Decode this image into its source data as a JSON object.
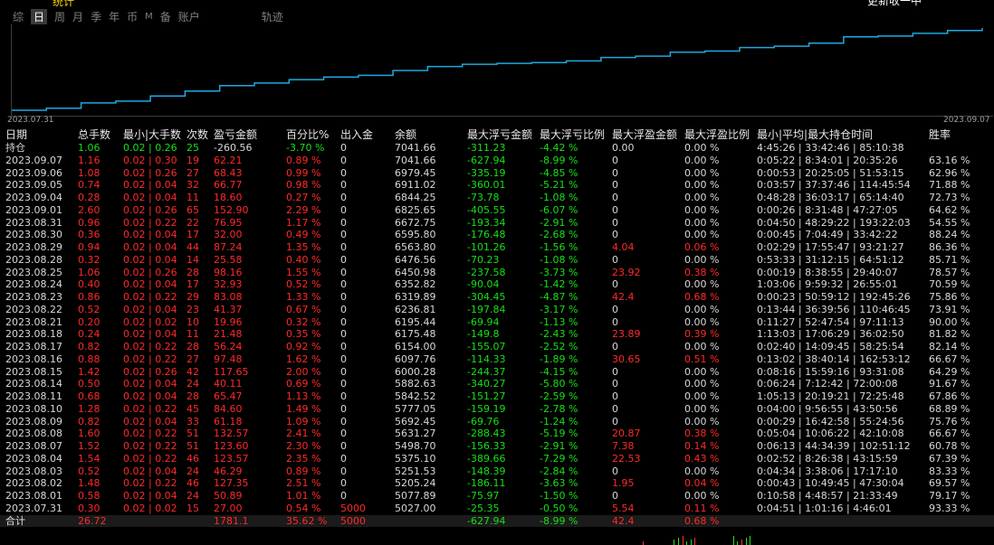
{
  "topbar": {
    "title_fragment": "统计",
    "right_fragment": "更新收一中",
    "tabs": [
      {
        "label": "综",
        "selected": false
      },
      {
        "label": "日",
        "selected": true
      },
      {
        "label": "周",
        "selected": false
      },
      {
        "label": "月",
        "selected": false
      },
      {
        "label": "季",
        "selected": false
      },
      {
        "label": "年",
        "selected": false
      },
      {
        "label": "币",
        "selected": false
      },
      {
        "label": "M",
        "selected": false
      },
      {
        "label": "备",
        "selected": false
      },
      {
        "label": "账户",
        "selected": false
      },
      {
        "label": "轨迹",
        "selected": false
      }
    ]
  },
  "chart_data": {
    "type": "line",
    "start_label": "2023.07.31",
    "end_label": "2023.09.07",
    "line_color": "#1fa8e0",
    "x": [
      "2023.07.31",
      "2023.08.01",
      "2023.08.02",
      "2023.08.03",
      "2023.08.04",
      "2023.08.07",
      "2023.08.08",
      "2023.08.09",
      "2023.08.10",
      "2023.08.11",
      "2023.08.14",
      "2023.08.15",
      "2023.08.16",
      "2023.08.17",
      "2023.08.18",
      "2023.08.21",
      "2023.08.22",
      "2023.08.23",
      "2023.08.24",
      "2023.08.25",
      "2023.08.28",
      "2023.08.29",
      "2023.08.30",
      "2023.08.31",
      "2023.09.01",
      "2023.09.04",
      "2023.09.05",
      "2023.09.06",
      "2023.09.07"
    ],
    "values": [
      5027.0,
      5077.89,
      5205.24,
      5251.53,
      5375.1,
      5498.7,
      5631.27,
      5692.45,
      5777.05,
      5842.52,
      5882.63,
      6000.28,
      6097.76,
      6154.0,
      6175.48,
      6195.44,
      6236.81,
      6319.89,
      6352.82,
      6450.98,
      6476.56,
      6563.8,
      6595.8,
      6672.75,
      6825.65,
      6844.25,
      6911.02,
      6979.45,
      7041.66
    ]
  },
  "table": {
    "headers": [
      "日期",
      "总手数",
      "最小|大手数",
      "次数",
      "盈亏金额",
      "百分比%",
      "出入金",
      "余额",
      "最大浮亏金额",
      "最大浮亏比例",
      "最大浮盈金额",
      "最大浮盈比例",
      "最小|平均|最大持仓时间",
      "胜率"
    ],
    "position_row": {
      "date": "持仓",
      "lots": "1.06",
      "minmax": "0.02 | 0.26",
      "count": "25",
      "pnl": "-260.56",
      "pct": "-3.70 %",
      "io": "0",
      "balance": "7041.66",
      "maxloss": "-311.23",
      "maxlosspct": "-4.42 %",
      "maxgain": "0.00",
      "maxgainpct": "0.00 %",
      "hold": "4:45:26 | 33:42:46 | 85:10:38",
      "win": ""
    },
    "rows": [
      {
        "date": "2023.09.07",
        "lots": "1.16",
        "minmax": "0.02 | 0.30",
        "count": "19",
        "pnl": "62.21",
        "pct": "0.89 %",
        "io": "0",
        "balance": "7041.66",
        "maxloss": "-627.94",
        "maxlosspct": "-8.99 %",
        "maxgain": "0",
        "maxgainpct": "0.00 %",
        "hold": "0:05:22 | 8:34:01 | 20:35:26",
        "win": "63.16 %"
      },
      {
        "date": "2023.09.06",
        "lots": "1.08",
        "minmax": "0.02 | 0.26",
        "count": "27",
        "pnl": "68.43",
        "pct": "0.99 %",
        "io": "0",
        "balance": "6979.45",
        "maxloss": "-335.19",
        "maxlosspct": "-4.85 %",
        "maxgain": "0",
        "maxgainpct": "0.00 %",
        "hold": "0:00:53 | 20:25:05 | 51:53:15",
        "win": "62.96 %"
      },
      {
        "date": "2023.09.05",
        "lots": "0.74",
        "minmax": "0.02 | 0.04",
        "count": "32",
        "pnl": "66.77",
        "pct": "0.98 %",
        "io": "0",
        "balance": "6911.02",
        "maxloss": "-360.01",
        "maxlosspct": "-5.21 %",
        "maxgain": "0",
        "maxgainpct": "0.00 %",
        "hold": "0:03:57 | 37:37:46 | 114:45:54",
        "win": "71.88 %"
      },
      {
        "date": "2023.09.04",
        "lots": "0.28",
        "minmax": "0.02 | 0.04",
        "count": "11",
        "pnl": "18.60",
        "pct": "0.27 %",
        "io": "0",
        "balance": "6844.25",
        "maxloss": "-73.78",
        "maxlosspct": "-1.08 %",
        "maxgain": "0",
        "maxgainpct": "0.00 %",
        "hold": "0:48:28 | 36:03:17 | 65:14:40",
        "win": "72.73 %"
      },
      {
        "date": "2023.09.01",
        "lots": "2.60",
        "minmax": "0.02 | 0.26",
        "count": "65",
        "pnl": "152.90",
        "pct": "2.29 %",
        "io": "0",
        "balance": "6825.65",
        "maxloss": "-405.55",
        "maxlosspct": "-6.07 %",
        "maxgain": "0",
        "maxgainpct": "0.00 %",
        "hold": "0:00:26 | 8:31:48 | 47:27:05",
        "win": "64.62 %"
      },
      {
        "date": "2023.08.31",
        "lots": "0.96",
        "minmax": "0.02 | 0.22",
        "count": "22",
        "pnl": "76.95",
        "pct": "1.17 %",
        "io": "0",
        "balance": "6672.75",
        "maxloss": "-193.34",
        "maxlosspct": "-2.91 %",
        "maxgain": "0",
        "maxgainpct": "0.00 %",
        "hold": "0:04:50 | 48:29:22 | 193:22:03",
        "win": "54.55 %"
      },
      {
        "date": "2023.08.30",
        "lots": "0.36",
        "minmax": "0.02 | 0.04",
        "count": "17",
        "pnl": "32.00",
        "pct": "0.49 %",
        "io": "0",
        "balance": "6595.80",
        "maxloss": "-176.48",
        "maxlosspct": "-2.68 %",
        "maxgain": "0",
        "maxgainpct": "0.00 %",
        "hold": "0:00:45 | 7:04:49 | 33:42:22",
        "win": "88.24 %"
      },
      {
        "date": "2023.08.29",
        "lots": "0.94",
        "minmax": "0.02 | 0.04",
        "count": "44",
        "pnl": "87.24",
        "pct": "1.35 %",
        "io": "0",
        "balance": "6563.80",
        "maxloss": "-101.26",
        "maxlosspct": "-1.56 %",
        "maxgain": "4.04",
        "maxgainpct": "0.06 %",
        "hold": "0:02:29 | 17:55:47 | 93:21:27",
        "win": "86.36 %"
      },
      {
        "date": "2023.08.28",
        "lots": "0.32",
        "minmax": "0.02 | 0.04",
        "count": "14",
        "pnl": "25.58",
        "pct": "0.40 %",
        "io": "0",
        "balance": "6476.56",
        "maxloss": "-70.23",
        "maxlosspct": "-1.08 %",
        "maxgain": "0",
        "maxgainpct": "0.00 %",
        "hold": "0:53:33 | 31:12:15 | 64:51:12",
        "win": "85.71 %"
      },
      {
        "date": "2023.08.25",
        "lots": "1.06",
        "minmax": "0.02 | 0.26",
        "count": "28",
        "pnl": "98.16",
        "pct": "1.55 %",
        "io": "0",
        "balance": "6450.98",
        "maxloss": "-237.58",
        "maxlosspct": "-3.73 %",
        "maxgain": "23.92",
        "maxgainpct": "0.38 %",
        "hold": "0:00:19 | 8:38:55 | 29:40:07",
        "win": "78.57 %"
      },
      {
        "date": "2023.08.24",
        "lots": "0.40",
        "minmax": "0.02 | 0.04",
        "count": "17",
        "pnl": "32.93",
        "pct": "0.52 %",
        "io": "0",
        "balance": "6352.82",
        "maxloss": "-90.04",
        "maxlosspct": "-1.42 %",
        "maxgain": "0",
        "maxgainpct": "0.00 %",
        "hold": "1:03:06 | 9:59:32 | 26:55:01",
        "win": "70.59 %"
      },
      {
        "date": "2023.08.23",
        "lots": "0.86",
        "minmax": "0.02 | 0.22",
        "count": "29",
        "pnl": "83.08",
        "pct": "1.33 %",
        "io": "0",
        "balance": "6319.89",
        "maxloss": "-304.45",
        "maxlosspct": "-4.87 %",
        "maxgain": "42.4",
        "maxgainpct": "0.68 %",
        "hold": "0:00:23 | 50:59:12 | 192:45:26",
        "win": "75.86 %"
      },
      {
        "date": "2023.08.22",
        "lots": "0.52",
        "minmax": "0.02 | 0.04",
        "count": "23",
        "pnl": "41.37",
        "pct": "0.67 %",
        "io": "0",
        "balance": "6236.81",
        "maxloss": "-197.84",
        "maxlosspct": "-3.17 %",
        "maxgain": "0",
        "maxgainpct": "0.00 %",
        "hold": "0:13:44 | 36:39:56 | 110:46:45",
        "win": "73.91 %"
      },
      {
        "date": "2023.08.21",
        "lots": "0.20",
        "minmax": "0.02 | 0.02",
        "count": "10",
        "pnl": "19.96",
        "pct": "0.32 %",
        "io": "0",
        "balance": "6195.44",
        "maxloss": "-69.94",
        "maxlosspct": "-1.13 %",
        "maxgain": "0",
        "maxgainpct": "0.00 %",
        "hold": "0:11:27 | 52:47:54 | 97:11:13",
        "win": "90.00 %"
      },
      {
        "date": "2023.08.18",
        "lots": "0.24",
        "minmax": "0.02 | 0.04",
        "count": "11",
        "pnl": "21.48",
        "pct": "0.35 %",
        "io": "0",
        "balance": "6175.48",
        "maxloss": "-149.8",
        "maxlosspct": "-2.43 %",
        "maxgain": "23.89",
        "maxgainpct": "0.39 %",
        "hold": "1:13:03 | 17:06:29 | 36:02:50",
        "win": "81.82 %"
      },
      {
        "date": "2023.08.17",
        "lots": "0.82",
        "minmax": "0.02 | 0.22",
        "count": "28",
        "pnl": "56.24",
        "pct": "0.92 %",
        "io": "0",
        "balance": "6154.00",
        "maxloss": "-155.07",
        "maxlosspct": "-2.52 %",
        "maxgain": "0",
        "maxgainpct": "0.00 %",
        "hold": "0:02:40 | 14:09:45 | 58:25:54",
        "win": "82.14 %"
      },
      {
        "date": "2023.08.16",
        "lots": "0.88",
        "minmax": "0.02 | 0.22",
        "count": "27",
        "pnl": "97.48",
        "pct": "1.62 %",
        "io": "0",
        "balance": "6097.76",
        "maxloss": "-114.33",
        "maxlosspct": "-1.89 %",
        "maxgain": "30.65",
        "maxgainpct": "0.51 %",
        "hold": "0:13:02 | 38:40:14 | 162:53:12",
        "win": "66.67 %"
      },
      {
        "date": "2023.08.15",
        "lots": "1.42",
        "minmax": "0.02 | 0.26",
        "count": "42",
        "pnl": "117.65",
        "pct": "2.00 %",
        "io": "0",
        "balance": "6000.28",
        "maxloss": "-244.37",
        "maxlosspct": "-4.15 %",
        "maxgain": "0",
        "maxgainpct": "0.00 %",
        "hold": "0:08:16 | 15:59:16 | 93:31:08",
        "win": "64.29 %"
      },
      {
        "date": "2023.08.14",
        "lots": "0.50",
        "minmax": "0.02 | 0.04",
        "count": "24",
        "pnl": "40.11",
        "pct": "0.69 %",
        "io": "0",
        "balance": "5882.63",
        "maxloss": "-340.27",
        "maxlosspct": "-5.80 %",
        "maxgain": "0",
        "maxgainpct": "0.00 %",
        "hold": "0:06:24 | 7:12:42 | 72:00:08",
        "win": "91.67 %"
      },
      {
        "date": "2023.08.11",
        "lots": "0.68",
        "minmax": "0.02 | 0.04",
        "count": "28",
        "pnl": "65.47",
        "pct": "1.13 %",
        "io": "0",
        "balance": "5842.52",
        "maxloss": "-151.27",
        "maxlosspct": "-2.59 %",
        "maxgain": "0",
        "maxgainpct": "0.00 %",
        "hold": "1:05:13 | 20:19:21 | 72:25:48",
        "win": "67.86 %"
      },
      {
        "date": "2023.08.10",
        "lots": "1.28",
        "minmax": "0.02 | 0.22",
        "count": "45",
        "pnl": "84.60",
        "pct": "1.49 %",
        "io": "0",
        "balance": "5777.05",
        "maxloss": "-159.19",
        "maxlosspct": "-2.78 %",
        "maxgain": "0",
        "maxgainpct": "0.00 %",
        "hold": "0:04:00 | 9:56:55 | 43:50:56",
        "win": "68.89 %"
      },
      {
        "date": "2023.08.09",
        "lots": "0.82",
        "minmax": "0.02 | 0.04",
        "count": "33",
        "pnl": "61.18",
        "pct": "1.09 %",
        "io": "0",
        "balance": "5692.45",
        "maxloss": "-69.76",
        "maxlosspct": "-1.24 %",
        "maxgain": "0",
        "maxgainpct": "0.00 %",
        "hold": "0:00:29 | 16:42:58 | 55:24:56",
        "win": "75.76 %"
      },
      {
        "date": "2023.08.08",
        "lots": "1.60",
        "minmax": "0.02 | 0.22",
        "count": "51",
        "pnl": "132.57",
        "pct": "2.41 %",
        "io": "0",
        "balance": "5631.27",
        "maxloss": "-288.43",
        "maxlosspct": "-5.19 %",
        "maxgain": "20.87",
        "maxgainpct": "0.38 %",
        "hold": "0:05:04 | 10:06:22 | 42:10:08",
        "win": "66.67 %"
      },
      {
        "date": "2023.08.07",
        "lots": "1.52",
        "minmax": "0.02 | 0.22",
        "count": "51",
        "pnl": "123.60",
        "pct": "2.30 %",
        "io": "0",
        "balance": "5498.70",
        "maxloss": "-156.33",
        "maxlosspct": "-2.91 %",
        "maxgain": "7.38",
        "maxgainpct": "0.14 %",
        "hold": "0:06:13 | 44:34:39 | 102:51:12",
        "win": "60.78 %"
      },
      {
        "date": "2023.08.04",
        "lots": "1.54",
        "minmax": "0.02 | 0.22",
        "count": "46",
        "pnl": "123.57",
        "pct": "2.35 %",
        "io": "0",
        "balance": "5375.10",
        "maxloss": "-389.66",
        "maxlosspct": "-7.29 %",
        "maxgain": "22.53",
        "maxgainpct": "0.43 %",
        "hold": "0:02:52 | 8:26:38 | 43:15:59",
        "win": "67.39 %"
      },
      {
        "date": "2023.08.03",
        "lots": "0.52",
        "minmax": "0.02 | 0.04",
        "count": "24",
        "pnl": "46.29",
        "pct": "0.89 %",
        "io": "0",
        "balance": "5251.53",
        "maxloss": "-148.39",
        "maxlosspct": "-2.84 %",
        "maxgain": "0",
        "maxgainpct": "0.00 %",
        "hold": "0:04:34 | 3:38:06 | 17:17:10",
        "win": "83.33 %"
      },
      {
        "date": "2023.08.02",
        "lots": "1.48",
        "minmax": "0.02 | 0.22",
        "count": "46",
        "pnl": "127.35",
        "pct": "2.51 %",
        "io": "0",
        "balance": "5205.24",
        "maxloss": "-186.11",
        "maxlosspct": "-3.63 %",
        "maxgain": "1.95",
        "maxgainpct": "0.04 %",
        "hold": "0:00:43 | 10:49:45 | 47:30:04",
        "win": "69.57 %"
      },
      {
        "date": "2023.08.01",
        "lots": "0.58",
        "minmax": "0.02 | 0.04",
        "count": "24",
        "pnl": "50.89",
        "pct": "1.01 %",
        "io": "0",
        "balance": "5077.89",
        "maxloss": "-75.97",
        "maxlosspct": "-1.50 %",
        "maxgain": "0",
        "maxgainpct": "0.00 %",
        "hold": "0:10:58 | 4:48:57 | 21:33:49",
        "win": "79.17 %"
      },
      {
        "date": "2023.07.31",
        "lots": "0.30",
        "minmax": "0.02 | 0.02",
        "count": "15",
        "pnl": "27.00",
        "pct": "0.54 %",
        "io": "5000",
        "balance": "5027.00",
        "maxloss": "-25.35",
        "maxlosspct": "-0.50 %",
        "maxgain": "5.54",
        "maxgainpct": "0.11 %",
        "hold": "0:04:51 | 1:01:16 | 4:46:01",
        "win": "93.33 %"
      }
    ],
    "total_row": {
      "date": "合计",
      "lots": "26.72",
      "minmax": "",
      "count": "",
      "pnl": "1781.1",
      "pct": "35.62 %",
      "io": "5000",
      "balance": "",
      "maxloss": "-627.94",
      "maxlosspct": "-8.99 %",
      "maxgain": "42.4",
      "maxgainpct": "0.68 %",
      "hold": "",
      "win": ""
    }
  }
}
